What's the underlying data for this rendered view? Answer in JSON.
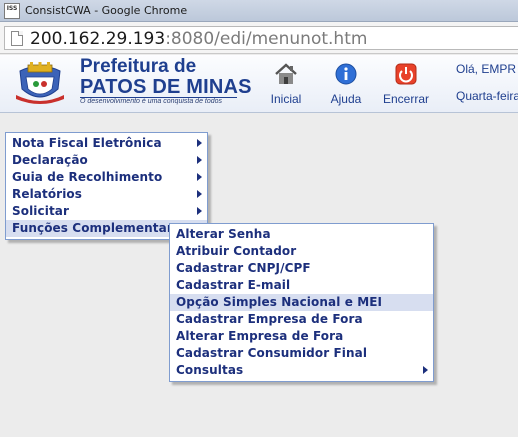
{
  "browser": {
    "window_title": "ConsistCWA - Google Chrome",
    "app_icon_text": "ISS",
    "url_host": "200.162.29.193",
    "url_rest": ":8080/edi/menunot.htm"
  },
  "header": {
    "brand_title": "Prefeitura de",
    "brand_sub": "PATOS DE MINAS",
    "tagline": "O desenvolvimento é uma conquista de todos",
    "nav": {
      "home_label": "Inicial",
      "help_label": "Ajuda",
      "exit_label": "Encerrar"
    },
    "greeting": "Olá, EMPR",
    "date": "Quarta-feira"
  },
  "menu": {
    "items": [
      {
        "label": "Nota Fiscal Eletrônica"
      },
      {
        "label": "Declaração"
      },
      {
        "label": "Guia de Recolhimento"
      },
      {
        "label": "Relatórios"
      },
      {
        "label": "Solicitar"
      },
      {
        "label": "Funções Complementares"
      }
    ]
  },
  "submenu": {
    "items": [
      {
        "label": "Alterar Senha"
      },
      {
        "label": "Atribuir Contador"
      },
      {
        "label": "Cadastrar CNPJ/CPF"
      },
      {
        "label": "Cadastrar E-mail"
      },
      {
        "label": "Opção Simples Nacional e MEI"
      },
      {
        "label": "Cadastrar Empresa de Fora"
      },
      {
        "label": "Alterar Empresa de Fora"
      },
      {
        "label": "Cadastrar Consumidor Final"
      },
      {
        "label": "Consultas"
      }
    ]
  },
  "colors": {
    "brand": "#1f3f8f",
    "menu_text": "#1c2f7c",
    "menu_highlight": "#d7def0",
    "menu_border": "#7f9ccf",
    "exit_red": "#e8412a",
    "help_blue": "#2f6fd6"
  }
}
